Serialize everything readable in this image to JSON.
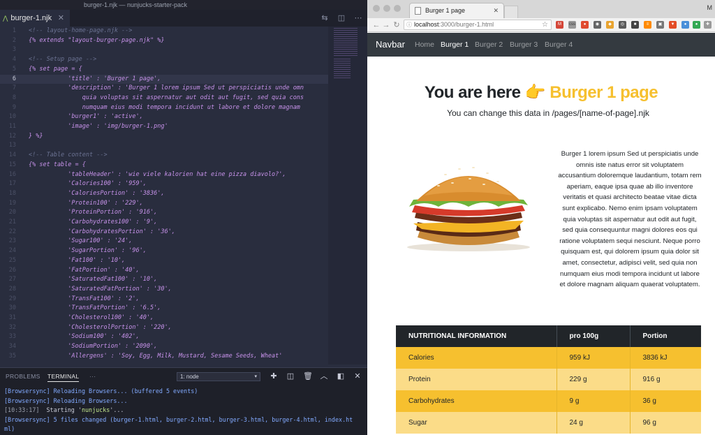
{
  "editor": {
    "window_title": "burger-1.njk — nunjucks-starter-pack",
    "tab_label": "burger-1.njk",
    "lines": [
      {
        "n": "1",
        "parts": [
          [
            "cmt",
            "<!-- layout-home-page.njk -->"
          ]
        ]
      },
      {
        "n": "2",
        "parts": [
          [
            "kw",
            "{% extends \"layout-burger-page.njk\" %}"
          ]
        ]
      },
      {
        "n": "3",
        "parts": []
      },
      {
        "n": "4",
        "parts": [
          [
            "cmt",
            "<!-- Setup page -->"
          ]
        ]
      },
      {
        "n": "5",
        "parts": [
          [
            "kw",
            "{% set page = {"
          ]
        ]
      },
      {
        "n": "6",
        "hl": true,
        "parts": [
          [
            "str",
            "           'title' : 'Burger 1 page',"
          ]
        ]
      },
      {
        "n": "7",
        "parts": [
          [
            "str",
            "           'description' : 'Burger 1 lorem ipsum Sed ut perspiciatis unde omn"
          ]
        ]
      },
      {
        "n": "8",
        "parts": [
          [
            "str",
            "               quia voluptas sit aspernatur aut odit aut fugit, sed quia cons"
          ]
        ]
      },
      {
        "n": "9",
        "parts": [
          [
            "str",
            "               numquam eius modi tempora incidunt ut labore et dolore magnam"
          ]
        ]
      },
      {
        "n": "10",
        "parts": [
          [
            "str",
            "           'burger1' : 'active',"
          ]
        ]
      },
      {
        "n": "11",
        "parts": [
          [
            "str",
            "           'image' : 'img/burger-1.png'"
          ]
        ]
      },
      {
        "n": "12",
        "parts": [
          [
            "kw",
            "} %}"
          ]
        ]
      },
      {
        "n": "13",
        "parts": []
      },
      {
        "n": "14",
        "parts": [
          [
            "cmt",
            "<!-- Table content -->"
          ]
        ]
      },
      {
        "n": "15",
        "parts": [
          [
            "kw",
            "{% set table = {"
          ]
        ]
      },
      {
        "n": "16",
        "parts": [
          [
            "str",
            "           'tableHeader' : 'wie viele kalorien hat eine pizza diavolo?',"
          ]
        ]
      },
      {
        "n": "17",
        "parts": [
          [
            "str",
            "           'Calories100' : '959',"
          ]
        ]
      },
      {
        "n": "18",
        "parts": [
          [
            "str",
            "           'CaloriesPortion' : '3836',"
          ]
        ]
      },
      {
        "n": "19",
        "parts": [
          [
            "str",
            "           'Protein100' : '229',"
          ]
        ]
      },
      {
        "n": "20",
        "parts": [
          [
            "str",
            "           'ProteinPortion' : '916',"
          ]
        ]
      },
      {
        "n": "21",
        "parts": [
          [
            "str",
            "           'Carbohydrates100' : '9',"
          ]
        ]
      },
      {
        "n": "22",
        "parts": [
          [
            "str",
            "           'CarbohydratesPortion' : '36',"
          ]
        ]
      },
      {
        "n": "23",
        "parts": [
          [
            "str",
            "           'Sugar100' : '24',"
          ]
        ]
      },
      {
        "n": "24",
        "parts": [
          [
            "str",
            "           'SugarPortion' : '96',"
          ]
        ]
      },
      {
        "n": "25",
        "parts": [
          [
            "str",
            "           'Fat100' : '10',"
          ]
        ]
      },
      {
        "n": "26",
        "parts": [
          [
            "str",
            "           'FatPortion' : '40',"
          ]
        ]
      },
      {
        "n": "27",
        "parts": [
          [
            "str",
            "           'SaturatedFat100' : '10',"
          ]
        ]
      },
      {
        "n": "28",
        "parts": [
          [
            "str",
            "           'SaturatedFatPortion' : '30',"
          ]
        ]
      },
      {
        "n": "29",
        "parts": [
          [
            "str",
            "           'TransFat100' : '2',"
          ]
        ]
      },
      {
        "n": "30",
        "parts": [
          [
            "str",
            "           'TransFatPortion' : '6.5',"
          ]
        ]
      },
      {
        "n": "31",
        "parts": [
          [
            "str",
            "           'Cholesterol100' : '40',"
          ]
        ]
      },
      {
        "n": "32",
        "parts": [
          [
            "str",
            "           'CholesterolPortion' : '220',"
          ]
        ]
      },
      {
        "n": "33",
        "parts": [
          [
            "str",
            "           'Sodium100' : '402',"
          ]
        ]
      },
      {
        "n": "34",
        "parts": [
          [
            "str",
            "           'SodiumPortion' : '2090',"
          ]
        ]
      },
      {
        "n": "35",
        "parts": [
          [
            "str",
            "           'Allergens' : 'Soy, Egg, Milk, Mustard, Sesame Seeds, Wheat'"
          ]
        ]
      }
    ]
  },
  "panel": {
    "tab_problems": "PROBLEMS",
    "tab_terminal": "TERMINAL",
    "tab_more": "···",
    "terminal_select": "1: node",
    "terminal": [
      [
        [
          "bs",
          "[Browsersync]"
        ],
        [
          "bs",
          " Reloading Browsers... (buffered 5 events)"
        ]
      ],
      [
        [
          "bs",
          "[Browsersync]"
        ],
        [
          "bs",
          " Reloading Browsers..."
        ]
      ],
      [
        [
          "ts",
          "[10:33:17]"
        ],
        [
          "",
          "  Starting '"
        ],
        [
          "pl",
          "nunjucks"
        ],
        [
          "",
          "'..."
        ]
      ],
      [
        [
          "bs",
          "[Browsersync]"
        ],
        [
          "bs",
          " 5 files changed (burger-1.html, burger-2.html, burger-3.html, burger-4.html, index.ht"
        ]
      ],
      [
        [
          "bs",
          "ml)"
        ]
      ],
      [
        [
          "ts",
          "[10:33:17]"
        ],
        [
          "",
          "  Finished '"
        ],
        [
          "pl",
          "nunjucks"
        ],
        [
          "",
          "' after "
        ],
        [
          "pl",
          "20 ms"
        ]
      ]
    ]
  },
  "browser": {
    "tab_title": "Burger 1 page",
    "user_initial": "M",
    "url_host": "localhost",
    "url_rest": ":3000/burger-1.html",
    "navbar": {
      "brand": "Navbar",
      "links": [
        "Home",
        "Burger 1",
        "Burger 2",
        "Burger 3",
        "Burger 4"
      ],
      "active_index": 1
    },
    "hero": {
      "title_prefix": "You are here",
      "hand": "👉",
      "title_page": "Burger 1 page",
      "subtitle": "You can change this data in /pages/[name-of-page].njk"
    },
    "description": "Burger 1 lorem ipsum Sed ut perspiciatis unde omnis iste natus error sit voluptatem accusantium doloremque laudantium, totam rem aperiam, eaque ipsa quae ab illo inventore veritatis et quasi architecto beatae vitae dicta sunt explicabo. Nemo enim ipsam voluptatem quia voluptas sit aspernatur aut odit aut fugit, sed quia consequuntur magni dolores eos qui ratione voluptatem sequi nesciunt. Neque porro quisquam est, qui dolorem ipsum quia dolor sit amet, consectetur, adipisci velit, sed quia non numquam eius modi tempora incidunt ut labore et dolore magnam aliquam quaerat voluptatem.",
    "table": {
      "headers": [
        "NUTRITIONAL INFORMATION",
        "pro 100g",
        "Portion"
      ],
      "rows": [
        [
          "Calories",
          "959 kJ",
          "3836 kJ"
        ],
        [
          "Protein",
          "229 g",
          "916 g"
        ],
        [
          "Carbohydrates",
          "9 g",
          "36 g"
        ],
        [
          "Sugar",
          "24 g",
          "96 g"
        ]
      ]
    }
  },
  "colors": {
    "editor_bg": "#292d3e",
    "accent_yellow": "#f6c02f",
    "navbar_bg": "#343a40"
  }
}
